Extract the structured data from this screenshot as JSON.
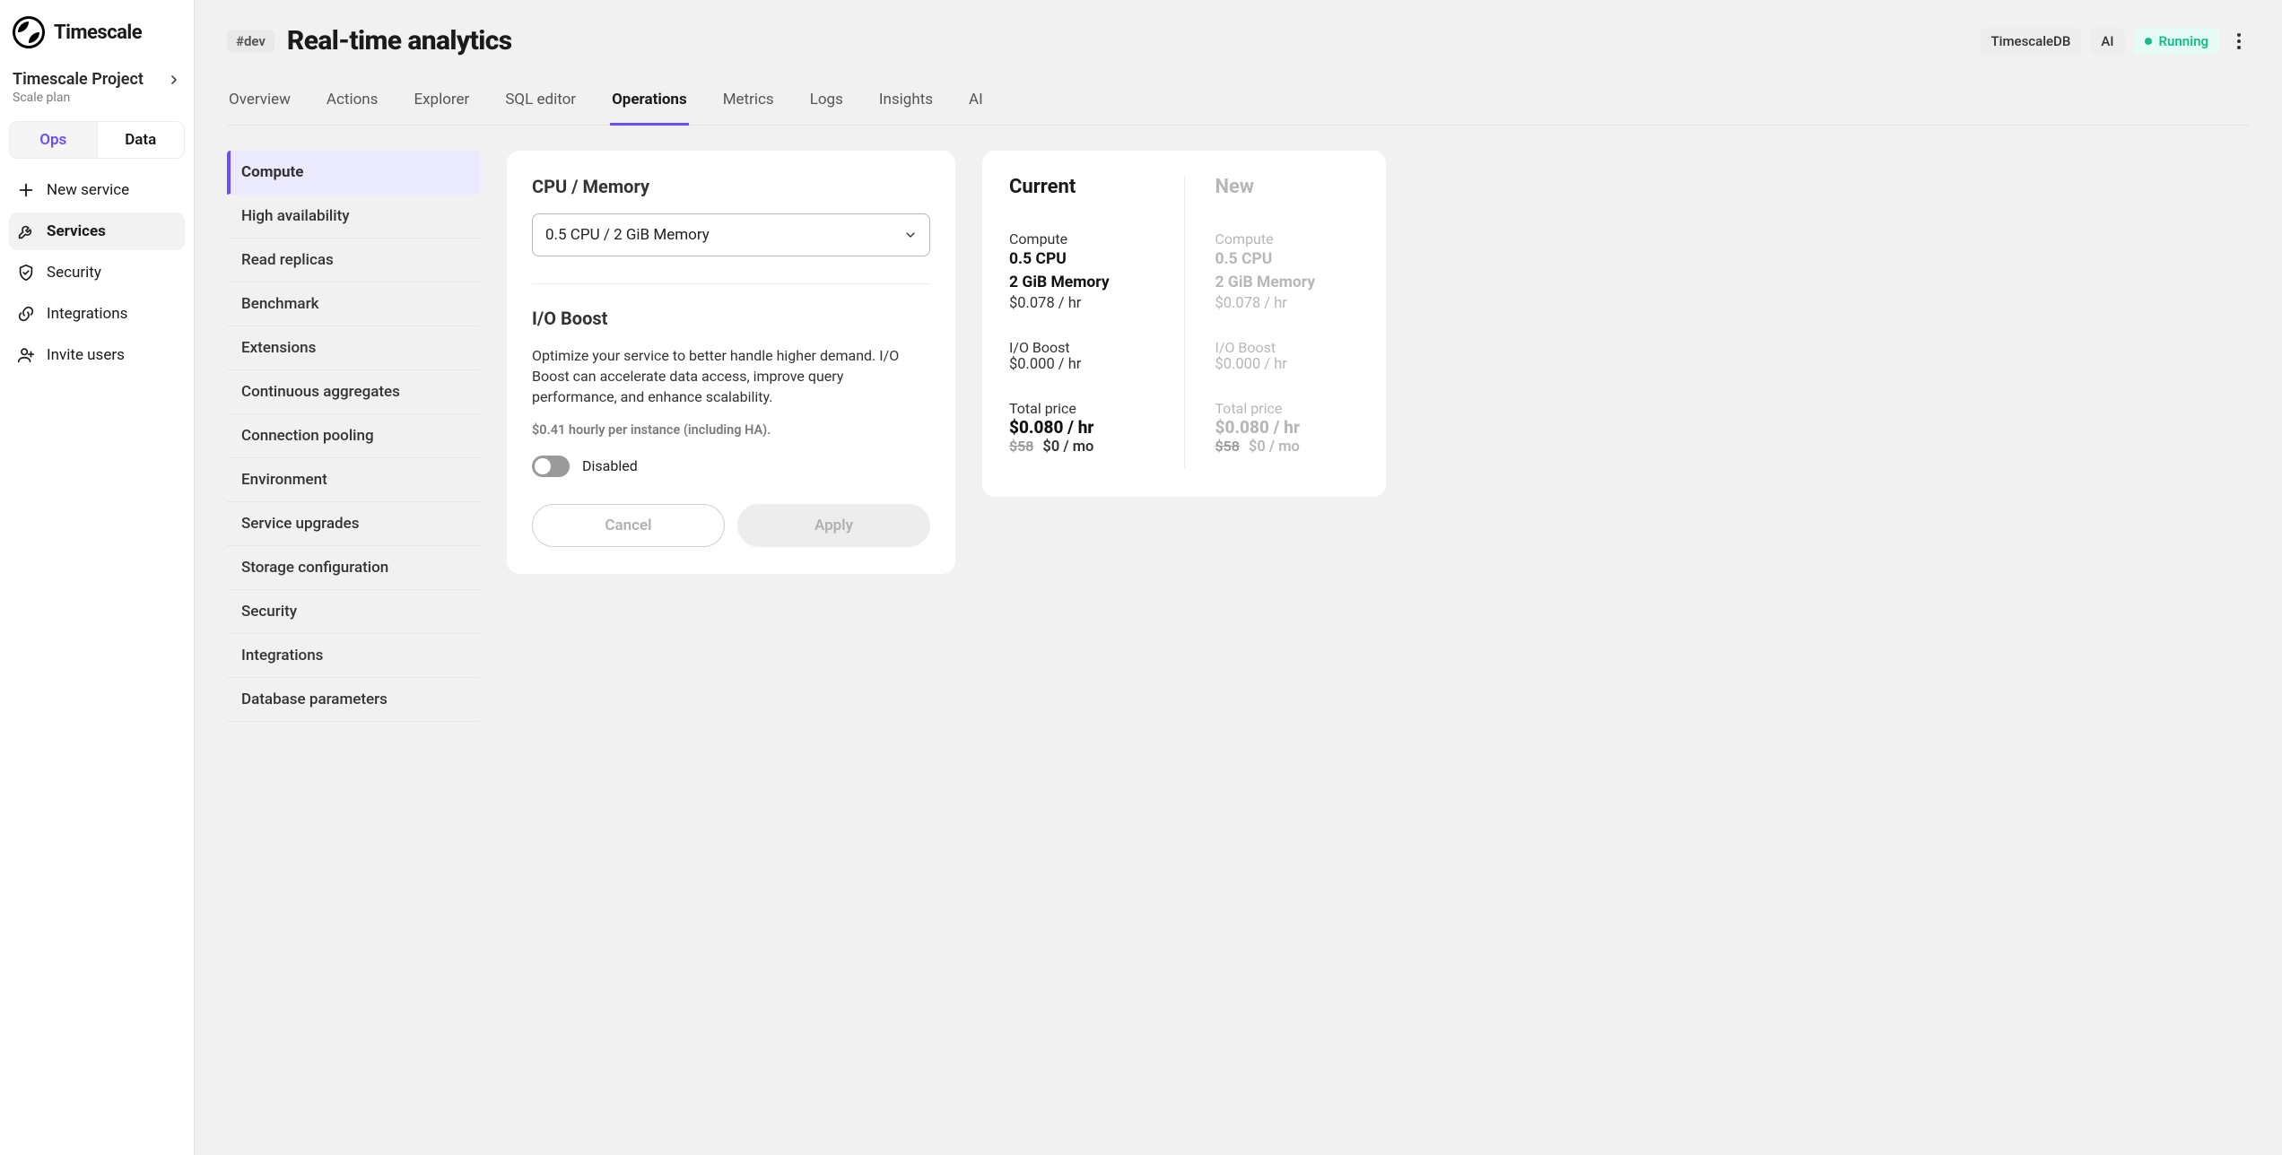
{
  "brand": "Timescale",
  "project": {
    "name": "Timescale Project",
    "plan": "Scale plan"
  },
  "sidebar": {
    "toggle": {
      "ops": "Ops",
      "data": "Data"
    },
    "items": [
      {
        "label": "New service",
        "icon": "plus"
      },
      {
        "label": "Services",
        "icon": "wrench",
        "active": true
      },
      {
        "label": "Security",
        "icon": "shield"
      },
      {
        "label": "Integrations",
        "icon": "link"
      },
      {
        "label": "Invite users",
        "icon": "user-plus"
      }
    ]
  },
  "header": {
    "env": "#dev",
    "title": "Real-time analytics",
    "chips": {
      "db": "TimescaleDB",
      "ai": "AI",
      "status": "Running"
    }
  },
  "tabs": [
    "Overview",
    "Actions",
    "Explorer",
    "SQL editor",
    "Operations",
    "Metrics",
    "Logs",
    "Insights",
    "AI"
  ],
  "active_tab": "Operations",
  "ops_nav": [
    "Compute",
    "High availability",
    "Read replicas",
    "Benchmark",
    "Extensions",
    "Continuous aggregates",
    "Connection pooling",
    "Environment",
    "Service upgrades",
    "Storage configuration",
    "Security",
    "Integrations",
    "Database parameters"
  ],
  "compute_panel": {
    "cpu_mem_title": "CPU / Memory",
    "cpu_mem_value": "0.5 CPU / 2 GiB Memory",
    "io_title": "I/O Boost",
    "io_desc": "Optimize your service to better handle higher demand. I/O Boost can accelerate data access, improve query performance, and enhance scalability.",
    "io_price_note": "$0.41 hourly per instance (including HA).",
    "io_toggle_state": "Disabled",
    "cancel": "Cancel",
    "apply": "Apply"
  },
  "pricing": {
    "current": {
      "head": "Current",
      "compute_label": "Compute",
      "cpu": "0.5 CPU",
      "mem": "2 GiB Memory",
      "compute_price": "$0.078 / hr",
      "io_label": "I/O Boost",
      "io_price": "$0.000 / hr",
      "total_label": "Total price",
      "total_hr": "$0.080 / hr",
      "total_mo_strike": "$58",
      "total_mo": "$0 / mo"
    },
    "new": {
      "head": "New",
      "compute_label": "Compute",
      "cpu": "0.5 CPU",
      "mem": "2 GiB Memory",
      "compute_price": "$0.078 / hr",
      "io_label": "I/O Boost",
      "io_price": "$0.000 / hr",
      "total_label": "Total price",
      "total_hr": "$0.080 / hr",
      "total_mo_strike": "$58",
      "total_mo": "$0 / mo"
    }
  }
}
